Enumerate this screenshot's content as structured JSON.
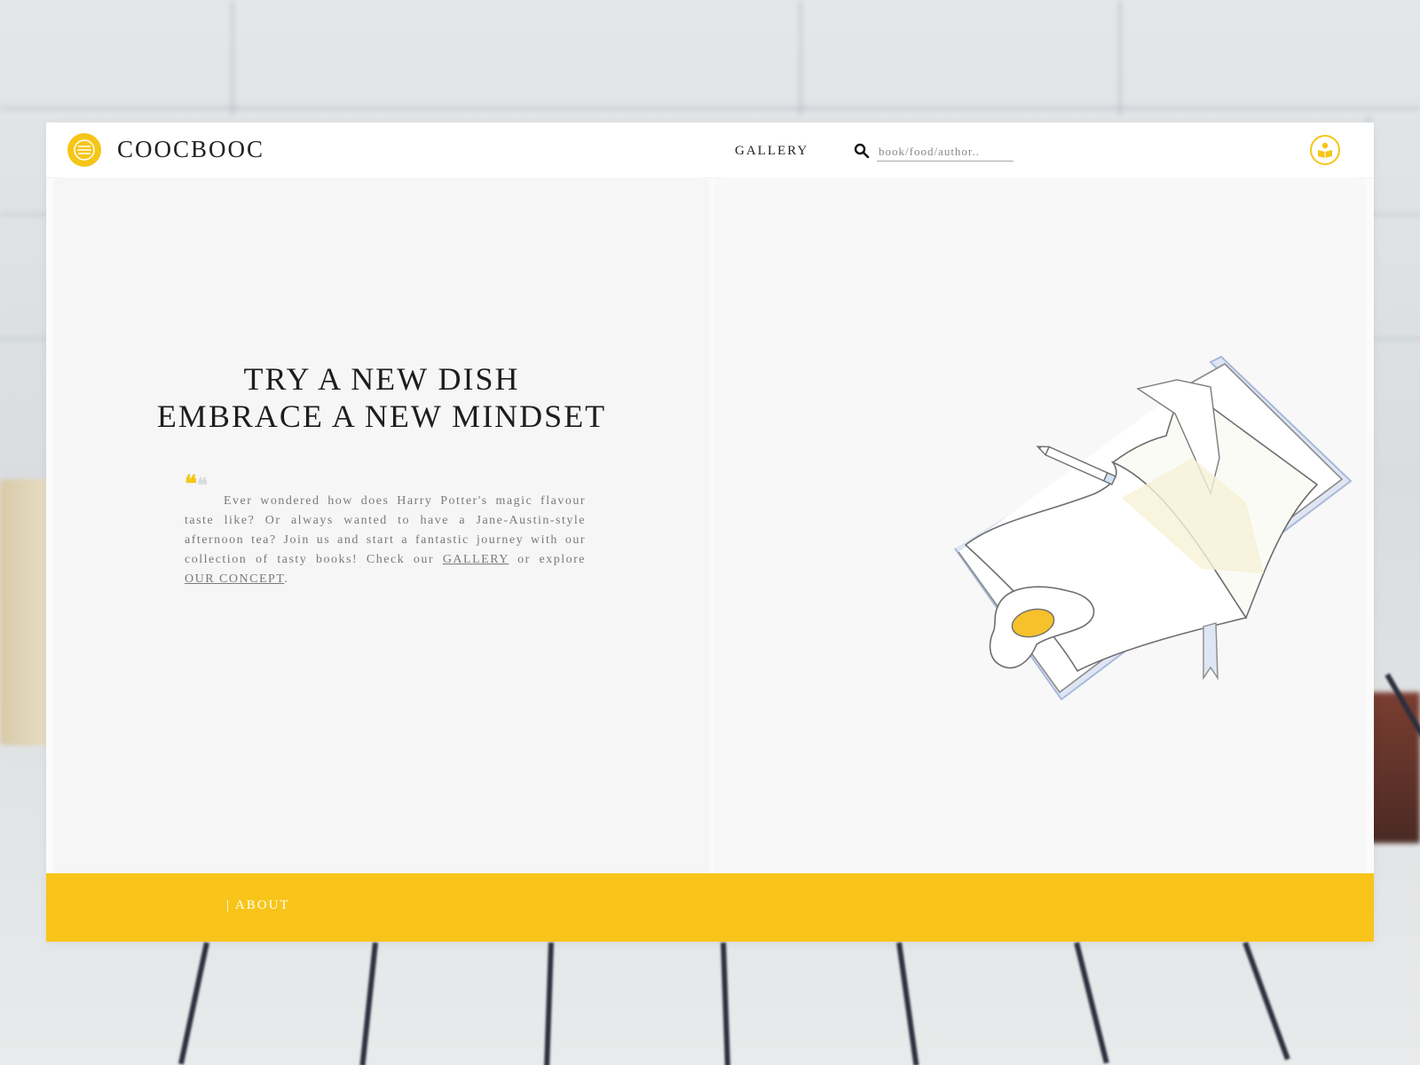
{
  "brand": {
    "name": "COOCBOOC",
    "logo_icon": "lemon-slice-icon",
    "accent_color": "#f5c518"
  },
  "nav": {
    "gallery_label": "GALLERY"
  },
  "search": {
    "icon": "search-icon",
    "placeholder": "book/food/author.."
  },
  "header": {
    "user_icon": "reader-profile-icon"
  },
  "hero": {
    "headline_line1": "TRY A NEW DISH",
    "headline_line2": "EMBRACE A NEW MINDSET",
    "quote_icon": "quote-mark-icon",
    "intro_text_1": "Ever wondered how does Harry Potter's magic flavour taste like? Or always wanted to have a Jane-Austin-style afternoon tea? Join us and start a fantastic journey with our collection of tasty books! Check our ",
    "intro_link_gallery": "GALLERY",
    "intro_text_2": " or explore ",
    "intro_link_concept": "OUR CONCEPT",
    "intro_text_3": ".",
    "illustration": "open-book-with-pencil-and-egg-illustration"
  },
  "footer": {
    "about_label": "| ABOUT",
    "color": "#f8c41a"
  }
}
